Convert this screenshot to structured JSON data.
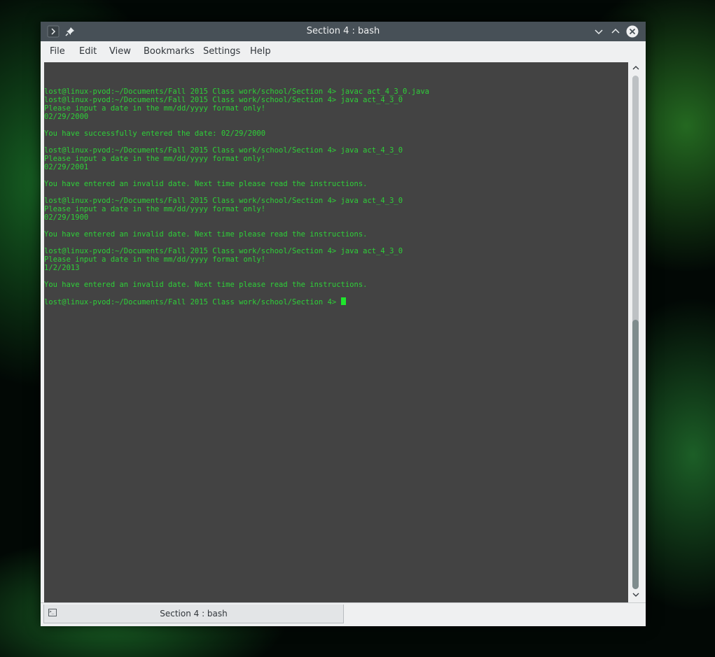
{
  "window": {
    "title": "Section 4 : bash",
    "icons": {
      "app": "terminal-prompt-icon",
      "pin": "pin-icon",
      "minimize": "chevron-down-icon",
      "maximize": "chevron-up-icon",
      "close": "close-icon"
    }
  },
  "menu": [
    "File",
    "Edit",
    "View",
    "Bookmarks",
    "Settings",
    "Help"
  ],
  "terminal": {
    "lines": [
      "",
      "",
      "",
      "lost@linux-pvod:~/Documents/Fall 2015 Class work/school/Section 4> javac act_4_3_0.java",
      "lost@linux-pvod:~/Documents/Fall 2015 Class work/school/Section 4> java act_4_3_0",
      "Please input a date in the mm/dd/yyyy format only!",
      "02/29/2000",
      "",
      "You have successfully entered the date: 02/29/2000",
      "",
      "lost@linux-pvod:~/Documents/Fall 2015 Class work/school/Section 4> java act_4_3_0",
      "Please input a date in the mm/dd/yyyy format only!",
      "02/29/2001",
      "",
      "You have entered an invalid date. Next time please read the instructions.",
      "",
      "lost@linux-pvod:~/Documents/Fall 2015 Class work/school/Section 4> java act_4_3_0",
      "Please input a date in the mm/dd/yyyy format only!",
      "02/29/1900",
      "",
      "You have entered an invalid date. Next time please read the instructions.",
      "",
      "lost@linux-pvod:~/Documents/Fall 2015 Class work/school/Section 4> java act_4_3_0",
      "Please input a date in the mm/dd/yyyy format only!",
      "1/2/2013",
      "",
      "You have entered an invalid date. Next time please read the instructions.",
      ""
    ],
    "prompt": "lost@linux-pvod:~/Documents/Fall 2015 Class work/school/Section 4> ",
    "text_color": "#2ed038",
    "cursor_color": "#1fe62c"
  },
  "scrollbar": {
    "up_icon": "chevron-up-icon",
    "down_icon": "chevron-down-icon"
  },
  "tabs": [
    {
      "label": "Section 4 : bash",
      "icon": "terminal-icon"
    }
  ]
}
